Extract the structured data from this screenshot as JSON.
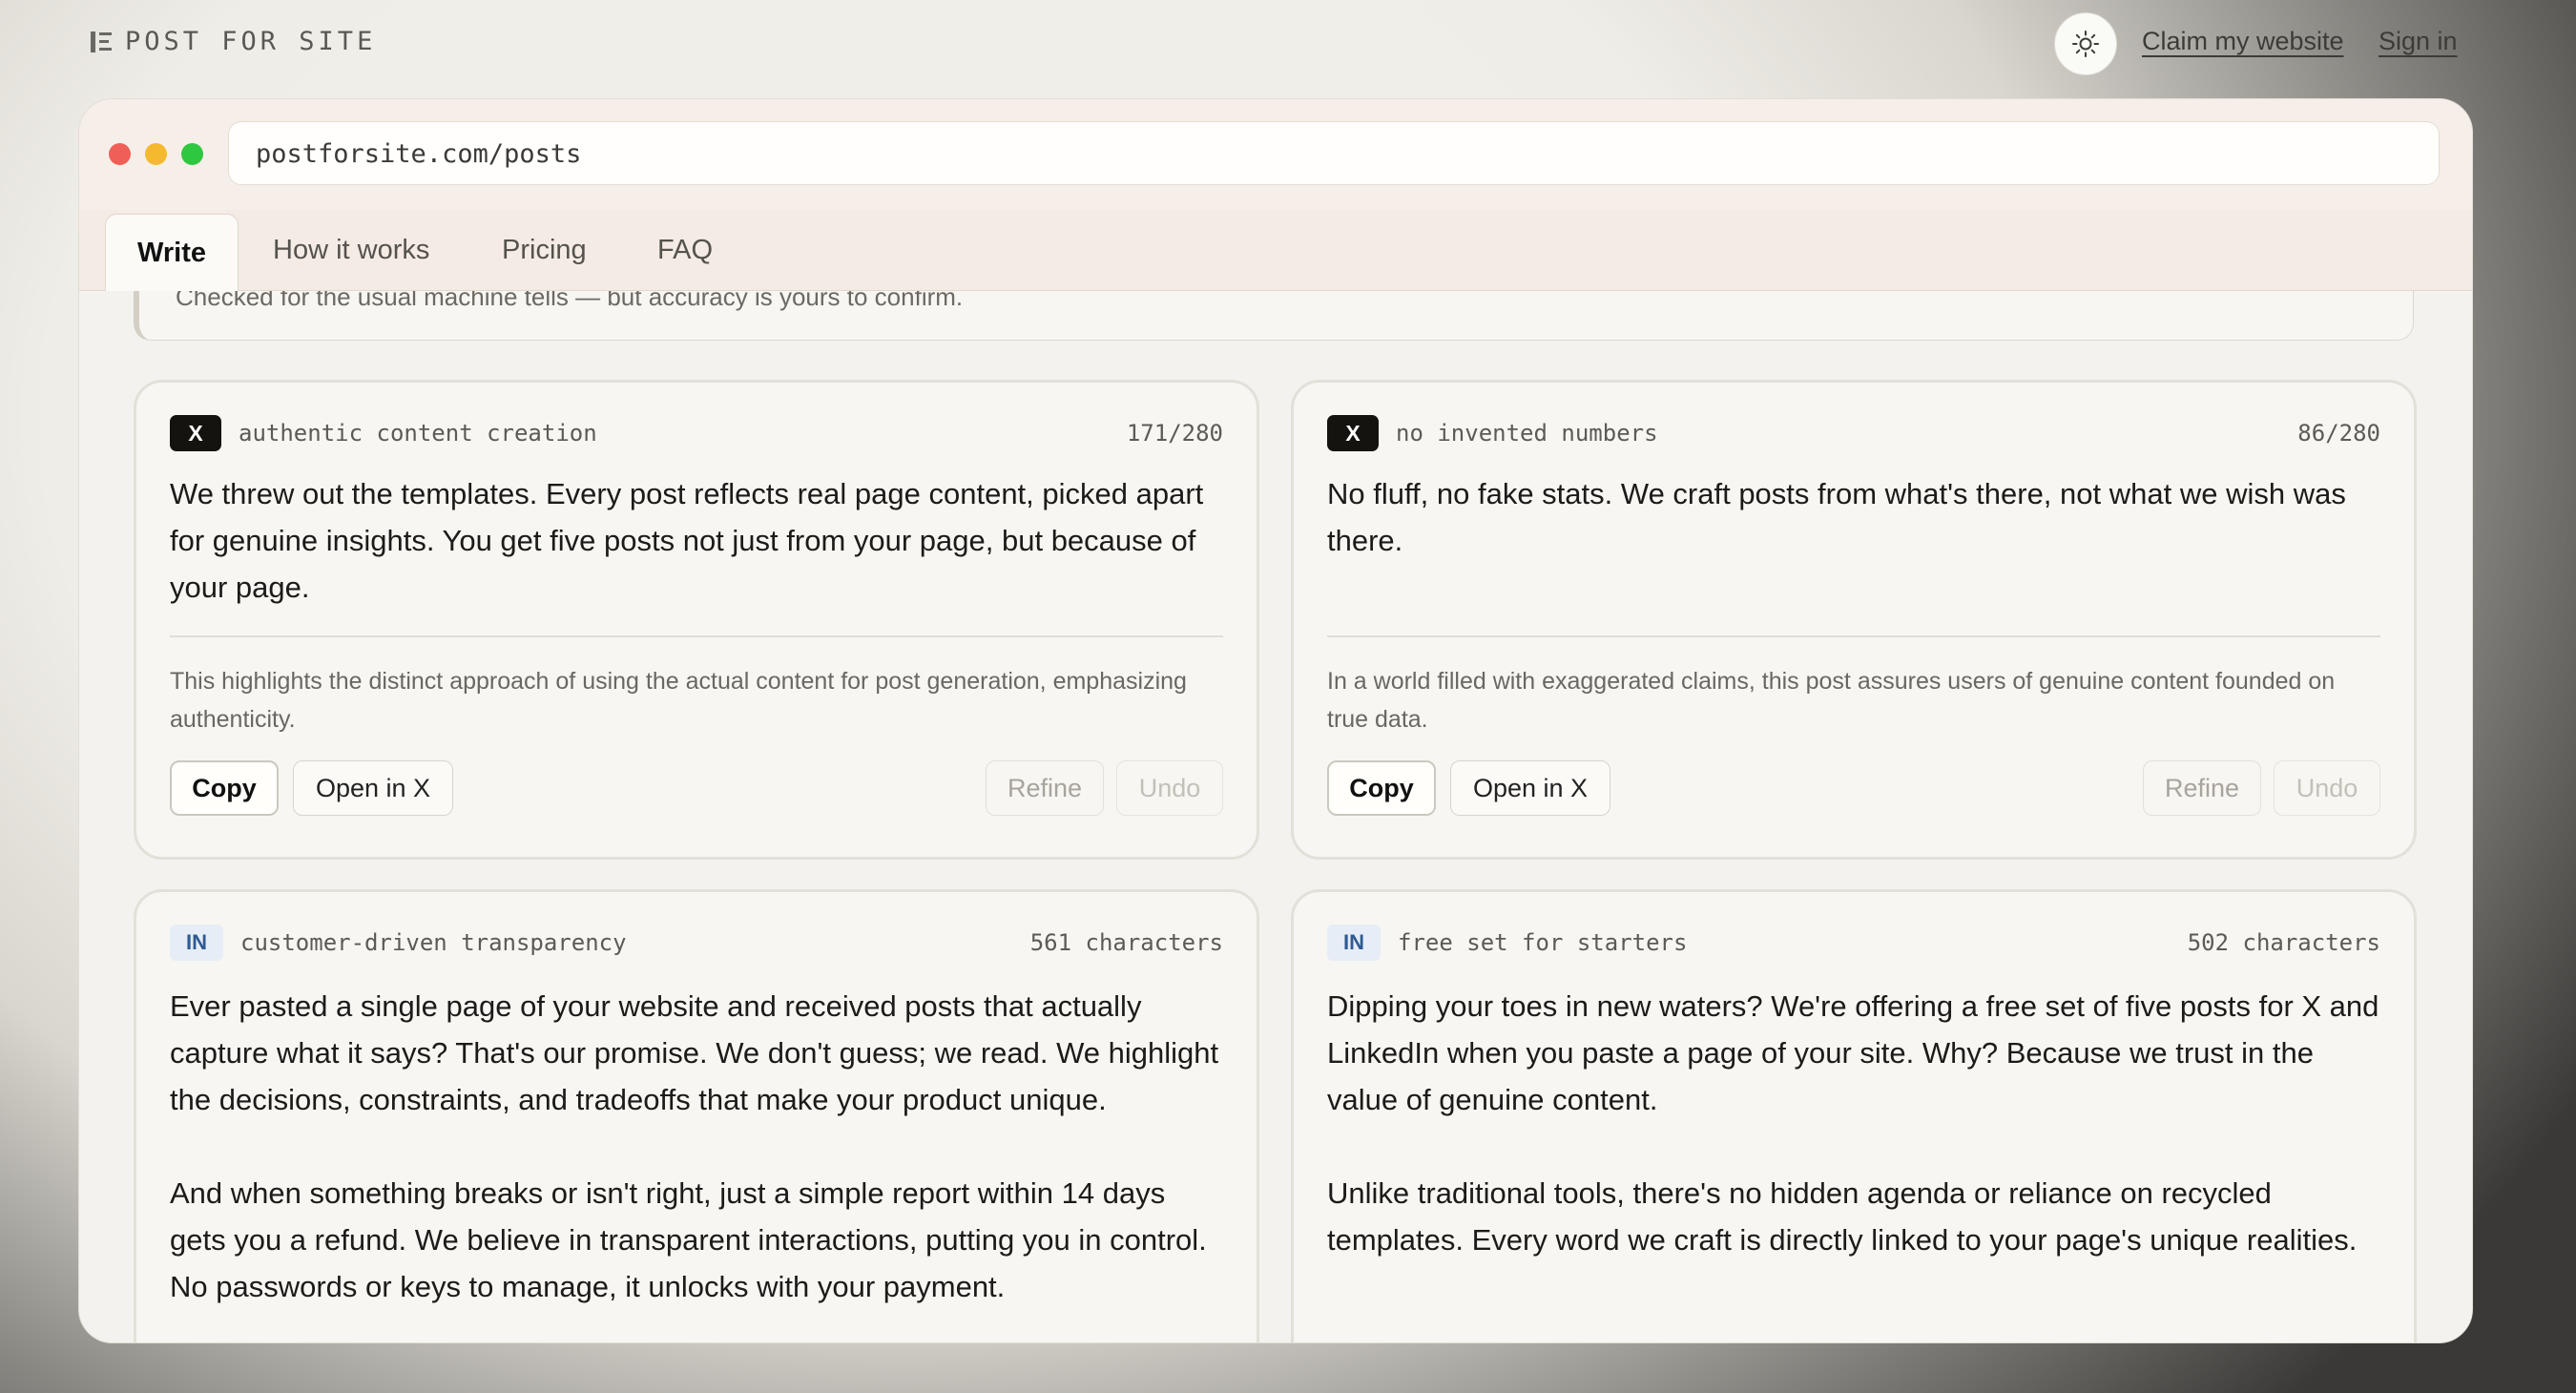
{
  "brand": {
    "name": "POST FOR SITE",
    "icon": "sidebar-layout-icon"
  },
  "topnav": {
    "theme_icon": "sun-icon",
    "claim": "Claim my website",
    "signin": "Sign in"
  },
  "browser": {
    "url": "postforsite.com/posts"
  },
  "tabs": [
    {
      "label": "Write",
      "active": true
    },
    {
      "label": "How it works",
      "active": false
    },
    {
      "label": "Pricing",
      "active": false
    },
    {
      "label": "FAQ",
      "active": false
    }
  ],
  "notice": "Checked for the usual machine tells — but accuracy is yours to confirm.",
  "posts": [
    {
      "platform": "X",
      "topic": "authentic content creation",
      "count": "171/280",
      "paragraphs": [
        "We threw out the templates. Every post reflects real page content, picked apart for genuine insights. You get five posts not just from your page, but because of your page."
      ],
      "note": "This highlights the distinct approach of using the actual content for post generation, emphasizing authenticity.",
      "actions": {
        "copy": "Copy",
        "open": "Open in X",
        "refine": "Refine",
        "undo": "Undo"
      }
    },
    {
      "platform": "X",
      "topic": "no invented numbers",
      "count": "86/280",
      "paragraphs": [
        "No fluff, no fake stats. We craft posts from what's there, not what we wish was there."
      ],
      "note": "In a world filled with exaggerated claims, this post assures users of genuine content founded on true data.",
      "actions": {
        "copy": "Copy",
        "open": "Open in X",
        "refine": "Refine",
        "undo": "Undo"
      }
    },
    {
      "platform": "IN",
      "topic": "customer-driven transparency",
      "count": "561 characters",
      "paragraphs": [
        "Ever pasted a single page of your website and received posts that actually capture what it says? That's our promise. We don't guess; we read. We highlight the decisions, constraints, and tradeoffs that make your product unique.",
        "And when something breaks or isn't right, just a simple report within 14 days gets you a refund. We believe in transparent interactions, putting you in control. No passwords or keys to manage, it unlocks with your payment."
      ]
    },
    {
      "platform": "IN",
      "topic": "free set for starters",
      "count": "502 characters",
      "paragraphs": [
        "Dipping your toes in new waters? We're offering a free set of five posts for X and LinkedIn when you paste a page of your site. Why? Because we trust in the value of genuine content.",
        "Unlike traditional tools, there's no hidden agenda or reliance on recycled templates. Every word we craft is directly linked to your page's unique realities."
      ]
    }
  ],
  "colors": {
    "dot_red": "#f05f57",
    "dot_yellow": "#f4b92e",
    "dot_green": "#2ec840",
    "x_badge": "#15130f",
    "in_badge_bg": "#e6edf6",
    "in_badge_text": "#2f5a92"
  }
}
